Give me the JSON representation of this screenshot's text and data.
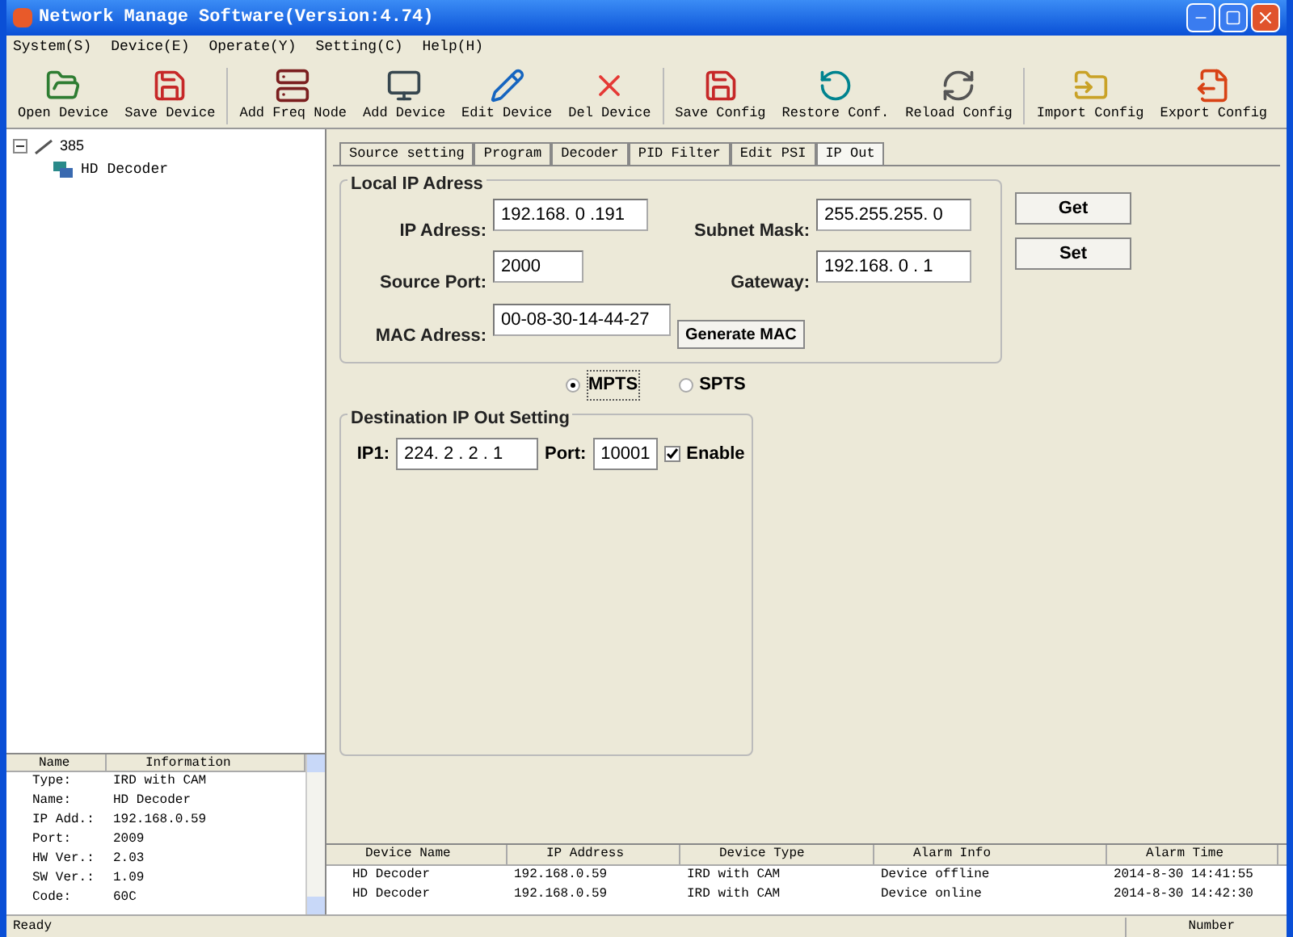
{
  "window": {
    "title": "Network Manage Software(Version:4.74)"
  },
  "menu": [
    {
      "label": "System(S)"
    },
    {
      "label": "Device(E)"
    },
    {
      "label": "Operate(Y)"
    },
    {
      "label": "Setting(C)"
    },
    {
      "label": "Help(H)"
    }
  ],
  "toolbar": [
    [
      {
        "label": "Open Device",
        "kind": "open"
      },
      {
        "label": "Save Device",
        "kind": "save"
      }
    ],
    [
      {
        "label": "Add Freq Node",
        "kind": "node"
      },
      {
        "label": "Add Device",
        "kind": "device"
      },
      {
        "label": "Edit Device",
        "kind": "edit"
      },
      {
        "label": "Del Device",
        "kind": "delete"
      }
    ],
    [
      {
        "label": "Save Config",
        "kind": "save"
      },
      {
        "label": "Restore Conf.",
        "kind": "restore"
      },
      {
        "label": "Reload Config",
        "kind": "reload"
      }
    ],
    [
      {
        "label": "Import Config",
        "kind": "import"
      },
      {
        "label": "Export Config",
        "kind": "export"
      }
    ]
  ],
  "tree": [
    {
      "label": "385",
      "expanded": true,
      "children": [
        {
          "label": "HD Decoder"
        }
      ]
    }
  ],
  "info_table": {
    "columns": [
      "Name",
      "Information"
    ],
    "rows": [
      {
        "name": "Type:",
        "value": "IRD with CAM"
      },
      {
        "name": "Name:",
        "value": "HD Decoder"
      },
      {
        "name": "IP Add.:",
        "value": "192.168.0.59"
      },
      {
        "name": "Port:",
        "value": "2009"
      },
      {
        "name": "HW Ver.:",
        "value": "2.03"
      },
      {
        "name": "SW Ver.:",
        "value": "1.09"
      },
      {
        "name": "Code:",
        "value": "60C"
      }
    ]
  },
  "tabs": [
    {
      "label": "Source setting",
      "selected": false
    },
    {
      "label": "Program",
      "selected": false
    },
    {
      "label": "Decoder",
      "selected": false
    },
    {
      "label": "PID Filter",
      "selected": false
    },
    {
      "label": "Edit PSI",
      "selected": false
    },
    {
      "label": "IP Out",
      "selected": true
    }
  ],
  "local_ip": {
    "title": "Local IP Adress",
    "ip_address": {
      "label": "IP Adress:",
      "value": "192.168. 0 .191"
    },
    "subnet_mask": {
      "label": "Subnet Mask:",
      "value": "255.255.255. 0"
    },
    "source_port": {
      "label": "Source Port:",
      "value": "2000"
    },
    "gateway": {
      "label": "Gateway:",
      "value": "192.168. 0 . 1"
    },
    "mac_address": {
      "label": "MAC Adress:",
      "value": "00-08-30-14-44-27"
    },
    "generate_button": "Generate MAC"
  },
  "buttons": [
    "Get",
    "Set"
  ],
  "mode": [
    {
      "label": "MPTS",
      "selected": true
    },
    {
      "label": "SPTS",
      "selected": false
    }
  ],
  "destination": {
    "title": "Destination IP Out Setting",
    "rows": [
      {
        "label": "IP1:",
        "value": "224. 2 . 2 . 1",
        "port_label": "Port:",
        "port": "10001",
        "enable_label": "Enable",
        "enabled": true
      }
    ]
  },
  "alarm_table": {
    "columns": [
      "Device Name",
      "IP Address",
      "Device Type",
      "Alarm Info",
      "Alarm Time"
    ],
    "rows": [
      [
        "HD Decoder",
        "192.168.0.59",
        "IRD with CAM",
        "Device offline",
        "2014-8-30 14:41:55"
      ],
      [
        "HD Decoder",
        "192.168.0.59",
        "IRD with CAM",
        "Device online",
        "2014-8-30 14:42:30"
      ]
    ]
  },
  "status_bar": {
    "text": "Ready",
    "panels": [
      "Number"
    ]
  }
}
